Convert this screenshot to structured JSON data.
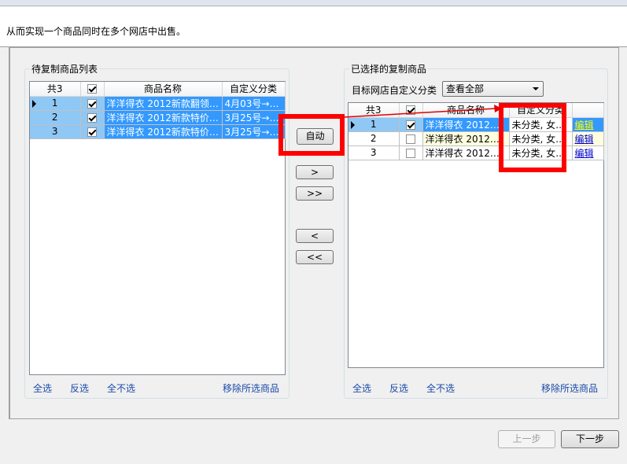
{
  "intro": "从而实现一个商品同时在多个网店中出售。",
  "left_panel": {
    "title": "待复制商品列表",
    "columns": [
      "共3",
      "",
      "商品名称",
      "自定义分类"
    ],
    "rows": [
      {
        "num": "1",
        "name": "洋洋得衣 2012新款翻领…",
        "category": "4月03号→…"
      },
      {
        "num": "2",
        "name": "洋洋得衣 2012新款特价…",
        "category": "3月25号→…"
      },
      {
        "num": "3",
        "name": "洋洋得衣 2012新款特价…",
        "category": "3月25号→…"
      }
    ],
    "select_all": "全选",
    "invert": "反选",
    "select_none": "全不选",
    "remove_selected": "移除所选商品"
  },
  "middle": {
    "auto": "自动",
    "move_right": ">",
    "move_all_right": ">>",
    "move_left": "<",
    "move_all_left": "<<"
  },
  "right_panel": {
    "title": "已选择的复制商品",
    "filter_label": "目标网店自定义分类",
    "filter_value": "查看全部",
    "columns": [
      "共3",
      "",
      "商品名称",
      "自定义分类",
      ""
    ],
    "rows": [
      {
        "num": "1",
        "name": "洋洋得衣 2012…",
        "category": "未分类, 女…",
        "edit": "编辑",
        "checked": true
      },
      {
        "num": "2",
        "name": "洋洋得衣 2012…",
        "category": "未分类, 女…",
        "edit": "编辑",
        "checked": false
      },
      {
        "num": "3",
        "name": "洋洋得衣 2012…",
        "category": "未分类, 女…",
        "edit": "编辑",
        "checked": false
      }
    ],
    "select_all": "全选",
    "invert": "反选",
    "select_none": "全不选",
    "remove_selected": "移除所选商品"
  },
  "footer": {
    "prev": "上一步",
    "next": "下一步"
  },
  "colors": {
    "selection": "#3399ff",
    "highlight": "#ff0000"
  }
}
